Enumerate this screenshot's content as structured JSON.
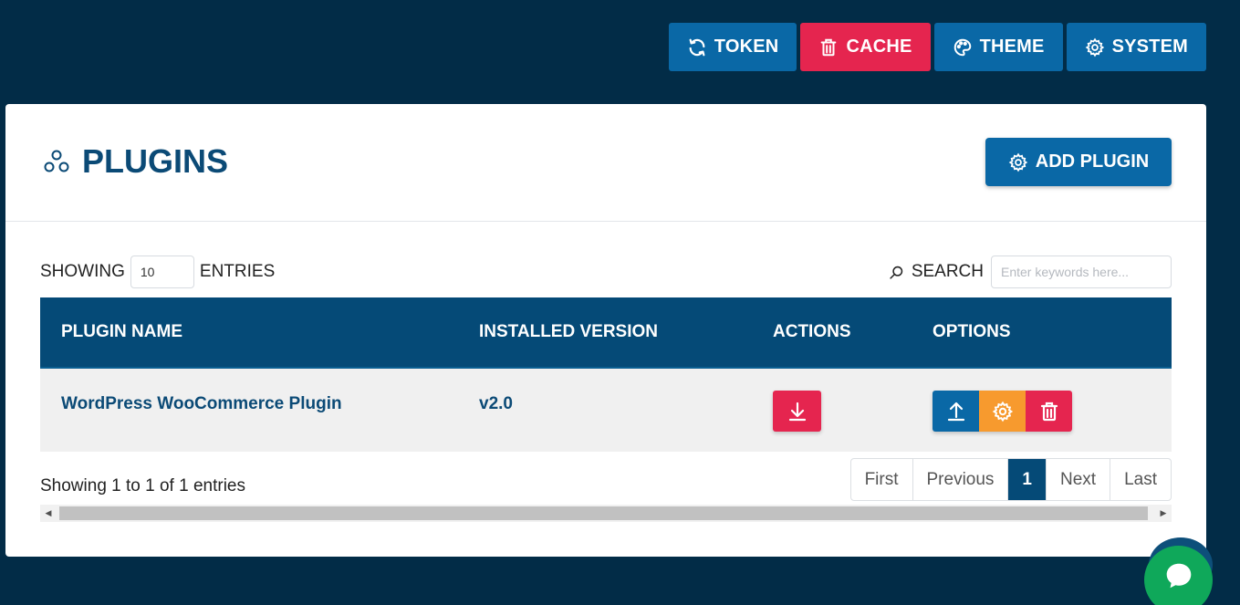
{
  "toolbar": {
    "token_label": "TOKEN",
    "cache_label": "CACHE",
    "theme_label": "THEME",
    "system_label": "SYSTEM"
  },
  "page": {
    "title": "PLUGINS",
    "add_label": "ADD PLUGIN"
  },
  "controls": {
    "showing_label": "SHOWING",
    "entries_value": "10",
    "entries_label": "ENTRIES",
    "search_label": "SEARCH",
    "search_placeholder": "Enter keywords here..."
  },
  "table": {
    "headers": [
      "PLUGIN NAME",
      "INSTALLED VERSION",
      "ACTIONS",
      "OPTIONS"
    ],
    "rows": [
      {
        "name": "WordPress WooCommerce Plugin",
        "version": "v2.0"
      }
    ]
  },
  "footer": {
    "info": "Showing 1 to 1 of 1 entries",
    "pages": [
      "First",
      "Previous",
      "1",
      "Next",
      "Last"
    ]
  },
  "icons": {
    "token": "refresh-icon",
    "cache": "trash-icon",
    "theme": "palette-icon",
    "system": "gear-icon",
    "title": "plugins-icon",
    "search": "search-icon"
  },
  "colors": {
    "background": "#022c47",
    "primary": "#0a68a6",
    "danger": "#e5254f",
    "warning": "#f79a2e",
    "header": "#054a77",
    "chat": "#0fa85a"
  }
}
